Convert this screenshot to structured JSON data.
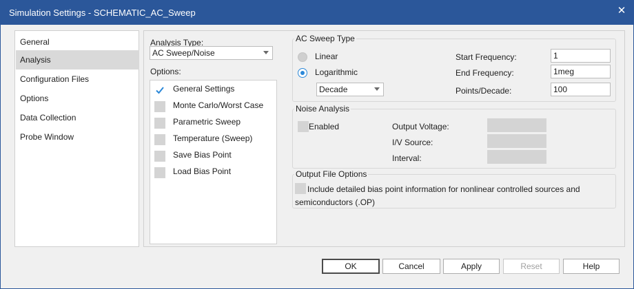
{
  "window": {
    "title": "Simulation Settings - SCHEMATIC_AC_Sweep",
    "close_glyph": "✕"
  },
  "sidebar": {
    "items": [
      {
        "label": "General",
        "selected": false
      },
      {
        "label": "Analysis",
        "selected": true
      },
      {
        "label": "Configuration Files",
        "selected": false
      },
      {
        "label": "Options",
        "selected": false
      },
      {
        "label": "Data Collection",
        "selected": false
      },
      {
        "label": "Probe Window",
        "selected": false
      }
    ]
  },
  "analysis": {
    "type_label": "Analysis Type:",
    "type_value": "AC Sweep/Noise",
    "options_label": "Options:",
    "options": [
      {
        "label": "General Settings",
        "checked": true
      },
      {
        "label": "Monte Carlo/Worst Case",
        "checked": false
      },
      {
        "label": "Parametric Sweep",
        "checked": false
      },
      {
        "label": "Temperature (Sweep)",
        "checked": false
      },
      {
        "label": "Save Bias Point",
        "checked": false
      },
      {
        "label": "Load Bias Point",
        "checked": false
      }
    ]
  },
  "ac_sweep": {
    "group_title": "AC Sweep Type",
    "linear_label": "Linear",
    "linear_selected": false,
    "log_label": "Logarithmic",
    "log_selected": true,
    "log_mode": "Decade",
    "start_label": "Start Frequency:",
    "start_value": "1",
    "end_label": "End Frequency:",
    "end_value": "1meg",
    "points_label": "Points/Decade:",
    "points_value": "100"
  },
  "noise": {
    "group_title": "Noise Analysis",
    "enabled_label": "Enabled",
    "enabled": false,
    "output_voltage_label": "Output Voltage:",
    "output_voltage_value": "",
    "iv_source_label": "I/V Source:",
    "iv_source_value": "",
    "interval_label": "Interval:",
    "interval_value": ""
  },
  "output_file": {
    "group_title": "Output File Options",
    "bias_line1": "Include detailed bias point information for nonlinear controlled sources and",
    "bias_line2": "semiconductors (.OP)",
    "bias_checked": false
  },
  "buttons": {
    "ok": "OK",
    "cancel": "Cancel",
    "apply": "Apply",
    "reset": "Reset",
    "help": "Help"
  },
  "colors": {
    "titlebar": "#2b579a",
    "radio_accent": "#2b88d8",
    "check_accent": "#2b88d8"
  }
}
